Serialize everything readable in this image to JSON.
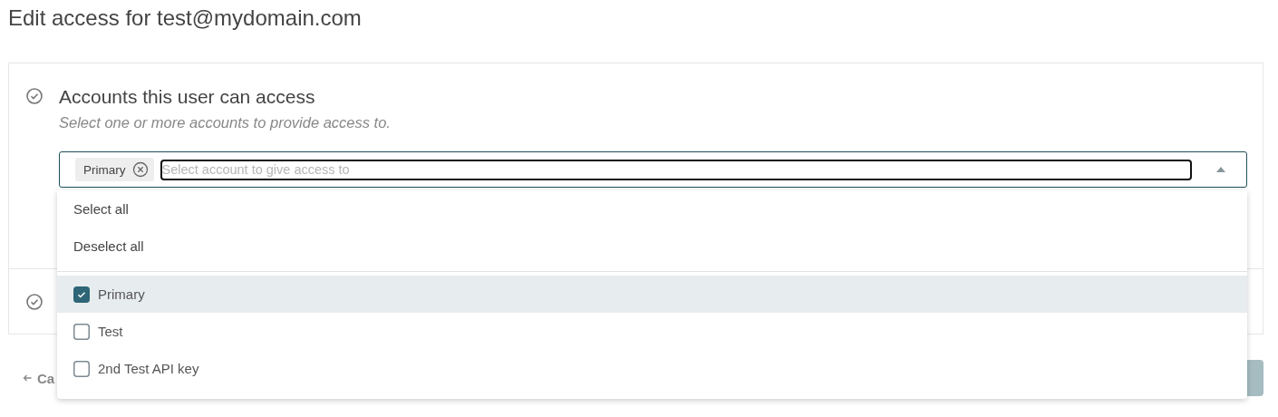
{
  "page": {
    "title": "Edit access for test@mydomain.com"
  },
  "accounts_section": {
    "heading": "Accounts this user can access",
    "hint": "Select one or more accounts to provide access to.",
    "complete": true
  },
  "second_section": {
    "complete": true
  },
  "account_select": {
    "chips": [
      "Primary"
    ],
    "placeholder": "Select account to give access to",
    "expanded": true
  },
  "dropdown": {
    "actions": [
      "Select all",
      "Deselect all"
    ],
    "options": [
      {
        "label": "Primary",
        "checked": true,
        "selected": true
      },
      {
        "label": "Test",
        "checked": false,
        "selected": false
      },
      {
        "label": "2nd Test API key",
        "checked": false,
        "selected": false
      }
    ]
  },
  "footer": {
    "cancel_link": "Ca"
  }
}
